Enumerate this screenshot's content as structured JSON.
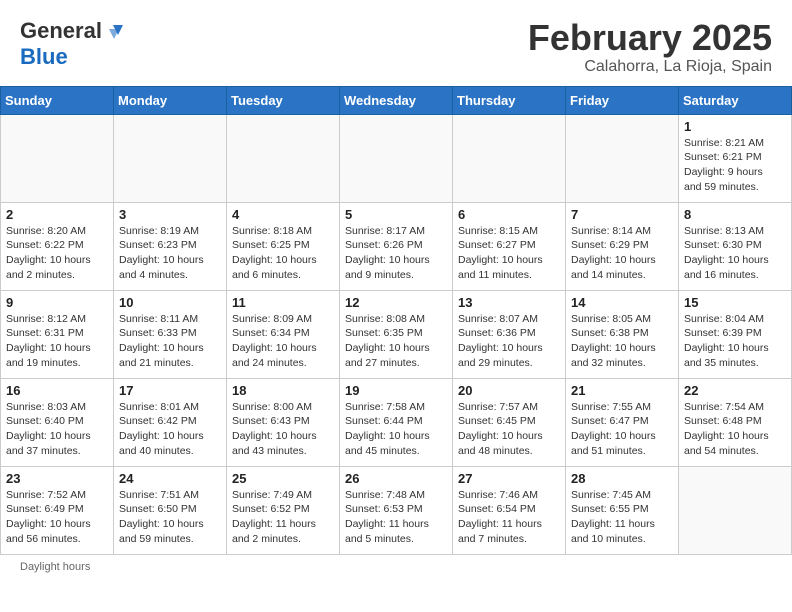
{
  "header": {
    "logo": {
      "general": "General",
      "blue": "Blue"
    },
    "month_year": "February 2025",
    "location": "Calahorra, La Rioja, Spain"
  },
  "days_of_week": [
    "Sunday",
    "Monday",
    "Tuesday",
    "Wednesday",
    "Thursday",
    "Friday",
    "Saturday"
  ],
  "weeks": [
    {
      "days": [
        {
          "num": "",
          "info": ""
        },
        {
          "num": "",
          "info": ""
        },
        {
          "num": "",
          "info": ""
        },
        {
          "num": "",
          "info": ""
        },
        {
          "num": "",
          "info": ""
        },
        {
          "num": "",
          "info": ""
        },
        {
          "num": "1",
          "info": "Sunrise: 8:21 AM\nSunset: 6:21 PM\nDaylight: 9 hours\nand 59 minutes."
        }
      ]
    },
    {
      "days": [
        {
          "num": "2",
          "info": "Sunrise: 8:20 AM\nSunset: 6:22 PM\nDaylight: 10 hours\nand 2 minutes."
        },
        {
          "num": "3",
          "info": "Sunrise: 8:19 AM\nSunset: 6:23 PM\nDaylight: 10 hours\nand 4 minutes."
        },
        {
          "num": "4",
          "info": "Sunrise: 8:18 AM\nSunset: 6:25 PM\nDaylight: 10 hours\nand 6 minutes."
        },
        {
          "num": "5",
          "info": "Sunrise: 8:17 AM\nSunset: 6:26 PM\nDaylight: 10 hours\nand 9 minutes."
        },
        {
          "num": "6",
          "info": "Sunrise: 8:15 AM\nSunset: 6:27 PM\nDaylight: 10 hours\nand 11 minutes."
        },
        {
          "num": "7",
          "info": "Sunrise: 8:14 AM\nSunset: 6:29 PM\nDaylight: 10 hours\nand 14 minutes."
        },
        {
          "num": "8",
          "info": "Sunrise: 8:13 AM\nSunset: 6:30 PM\nDaylight: 10 hours\nand 16 minutes."
        }
      ]
    },
    {
      "days": [
        {
          "num": "9",
          "info": "Sunrise: 8:12 AM\nSunset: 6:31 PM\nDaylight: 10 hours\nand 19 minutes."
        },
        {
          "num": "10",
          "info": "Sunrise: 8:11 AM\nSunset: 6:33 PM\nDaylight: 10 hours\nand 21 minutes."
        },
        {
          "num": "11",
          "info": "Sunrise: 8:09 AM\nSunset: 6:34 PM\nDaylight: 10 hours\nand 24 minutes."
        },
        {
          "num": "12",
          "info": "Sunrise: 8:08 AM\nSunset: 6:35 PM\nDaylight: 10 hours\nand 27 minutes."
        },
        {
          "num": "13",
          "info": "Sunrise: 8:07 AM\nSunset: 6:36 PM\nDaylight: 10 hours\nand 29 minutes."
        },
        {
          "num": "14",
          "info": "Sunrise: 8:05 AM\nSunset: 6:38 PM\nDaylight: 10 hours\nand 32 minutes."
        },
        {
          "num": "15",
          "info": "Sunrise: 8:04 AM\nSunset: 6:39 PM\nDaylight: 10 hours\nand 35 minutes."
        }
      ]
    },
    {
      "days": [
        {
          "num": "16",
          "info": "Sunrise: 8:03 AM\nSunset: 6:40 PM\nDaylight: 10 hours\nand 37 minutes."
        },
        {
          "num": "17",
          "info": "Sunrise: 8:01 AM\nSunset: 6:42 PM\nDaylight: 10 hours\nand 40 minutes."
        },
        {
          "num": "18",
          "info": "Sunrise: 8:00 AM\nSunset: 6:43 PM\nDaylight: 10 hours\nand 43 minutes."
        },
        {
          "num": "19",
          "info": "Sunrise: 7:58 AM\nSunset: 6:44 PM\nDaylight: 10 hours\nand 45 minutes."
        },
        {
          "num": "20",
          "info": "Sunrise: 7:57 AM\nSunset: 6:45 PM\nDaylight: 10 hours\nand 48 minutes."
        },
        {
          "num": "21",
          "info": "Sunrise: 7:55 AM\nSunset: 6:47 PM\nDaylight: 10 hours\nand 51 minutes."
        },
        {
          "num": "22",
          "info": "Sunrise: 7:54 AM\nSunset: 6:48 PM\nDaylight: 10 hours\nand 54 minutes."
        }
      ]
    },
    {
      "days": [
        {
          "num": "23",
          "info": "Sunrise: 7:52 AM\nSunset: 6:49 PM\nDaylight: 10 hours\nand 56 minutes."
        },
        {
          "num": "24",
          "info": "Sunrise: 7:51 AM\nSunset: 6:50 PM\nDaylight: 10 hours\nand 59 minutes."
        },
        {
          "num": "25",
          "info": "Sunrise: 7:49 AM\nSunset: 6:52 PM\nDaylight: 11 hours\nand 2 minutes."
        },
        {
          "num": "26",
          "info": "Sunrise: 7:48 AM\nSunset: 6:53 PM\nDaylight: 11 hours\nand 5 minutes."
        },
        {
          "num": "27",
          "info": "Sunrise: 7:46 AM\nSunset: 6:54 PM\nDaylight: 11 hours\nand 7 minutes."
        },
        {
          "num": "28",
          "info": "Sunrise: 7:45 AM\nSunset: 6:55 PM\nDaylight: 11 hours\nand 10 minutes."
        },
        {
          "num": "",
          "info": ""
        }
      ]
    }
  ],
  "footer": {
    "note": "Daylight hours"
  }
}
